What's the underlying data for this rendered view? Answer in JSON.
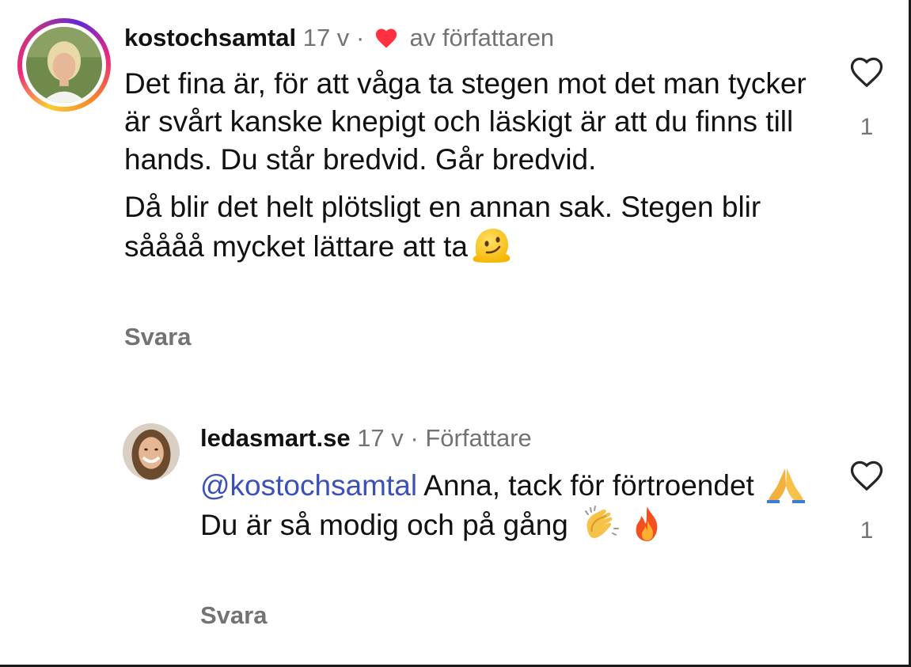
{
  "comments": [
    {
      "username": "kostochsamtal",
      "time": "17 v",
      "separator": "·",
      "author_like_label": "av författaren",
      "paragraphs": [
        "Det fina är, för att våga ta stegen mot det man tycker är svårt kanske knepigt och läskigt är att du finns till hands. Du står bredvid. Går bredvid.",
        "Då blir det helt plötsligt en annan sak. Stegen blir såååå mycket lättare att ta"
      ],
      "emoji": "melting-face",
      "reply_label": "Svara",
      "like_count": "1"
    },
    {
      "username": "ledasmart.se",
      "time": "17 v",
      "separator": "·",
      "author_badge": "Författare",
      "mention": "@kostochsamtal",
      "text_part1": " Anna, tack för förtroendet ",
      "text_part2": " Du är så modig och på gång ",
      "emojis": [
        "folded-hands",
        "clapping-hands",
        "fire"
      ],
      "reply_label": "Svara",
      "like_count": "1"
    }
  ],
  "colors": {
    "text": "#111111",
    "meta": "#737373",
    "mention": "#3b50b8",
    "heart_red": "#ff3040"
  }
}
